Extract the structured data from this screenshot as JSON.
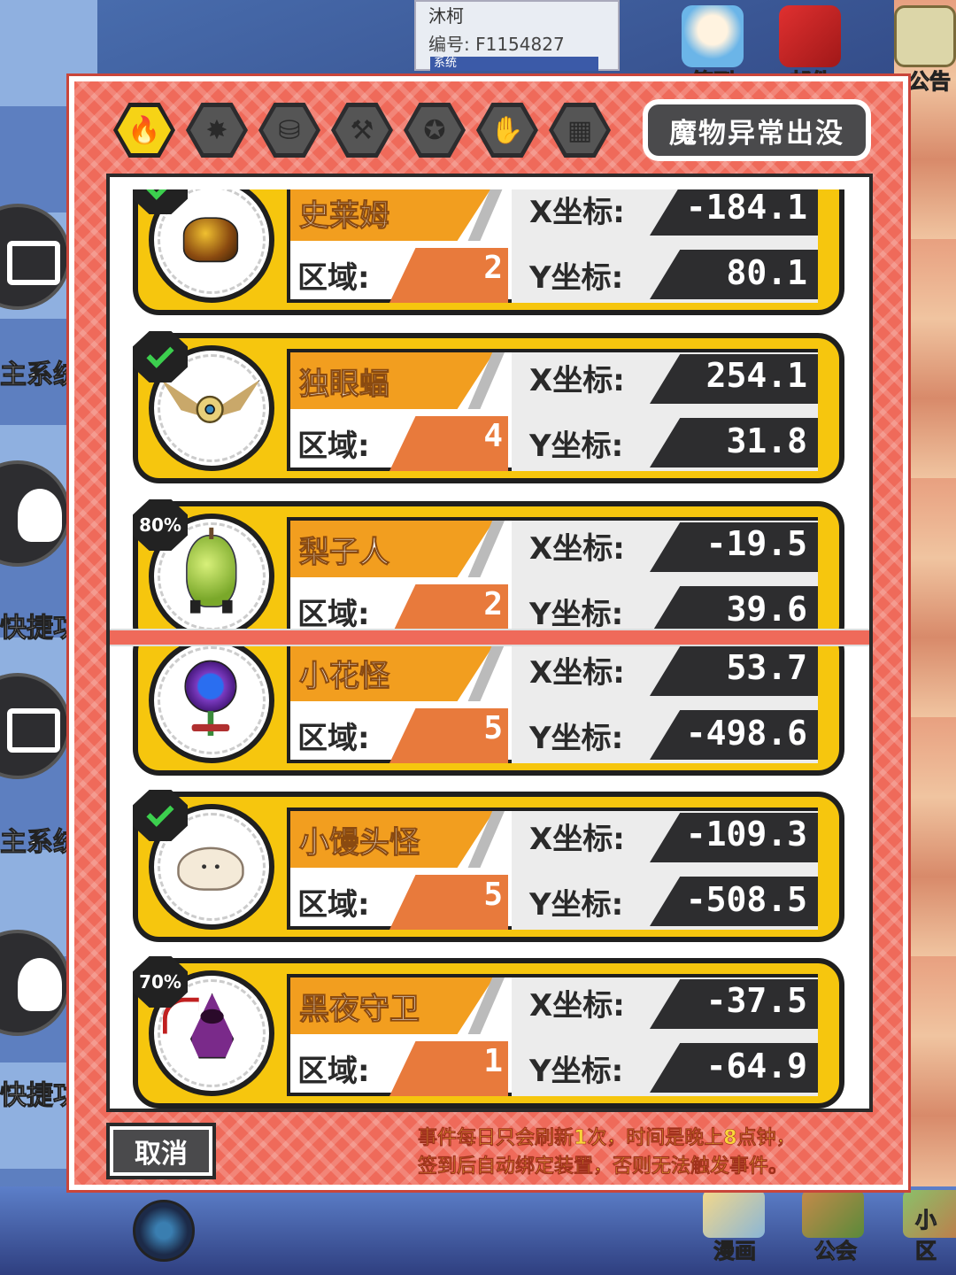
{
  "background": {
    "player_name": "沐柯",
    "player_id": "编号: F1154827",
    "system_label": "系统",
    "top_buttons": [
      {
        "label": "签到",
        "icon": "mascot-icon"
      },
      {
        "label": "邮件",
        "icon": "mail-icon"
      },
      {
        "label": "公告",
        "icon": "notice-board-icon"
      }
    ],
    "side_buttons": [
      {
        "label": "主系统",
        "icon": "window-icon"
      },
      {
        "label": "快捷功",
        "icon": "lightbulb-icon"
      }
    ],
    "bottom_buttons": [
      {
        "label": "漫画",
        "icon": "comic-icon"
      },
      {
        "label": "公会",
        "icon": "guild-icon"
      },
      {
        "label": "小区",
        "icon": "house-icon"
      }
    ]
  },
  "dialog": {
    "title": "魔物异常出没",
    "tabs": [
      {
        "icon": "flame-icon",
        "glyph": "🔥",
        "active": true
      },
      {
        "icon": "fire-burst-icon",
        "glyph": "✸",
        "active": false
      },
      {
        "icon": "coins-icon",
        "glyph": "⛁",
        "active": false
      },
      {
        "icon": "hammer-icon",
        "glyph": "⚒",
        "active": false
      },
      {
        "icon": "star-coin-icon",
        "glyph": "✪",
        "active": false
      },
      {
        "icon": "glove-icon",
        "glyph": "✋",
        "active": false
      },
      {
        "icon": "grid-icon",
        "glyph": "▦",
        "active": false
      }
    ],
    "labels": {
      "region": "区域:",
      "x": "X坐标:",
      "y": "Y坐标:"
    },
    "monsters_top": [
      {
        "name": "史莱姆",
        "region": "2",
        "x": "-184.1",
        "y": "80.1",
        "badge": "check",
        "icon": "slime-icon"
      },
      {
        "name": "独眼蝠",
        "region": "4",
        "x": "254.1",
        "y": "31.8",
        "badge": "check",
        "icon": "one-eyed-bat-icon"
      },
      {
        "name": "梨子人",
        "region": "2",
        "x": "-19.5",
        "y": "39.6",
        "badge": "80%",
        "icon": "pear-man-icon"
      }
    ],
    "monsters_bottom": [
      {
        "name": "小花怪",
        "region": "5",
        "x": "53.7",
        "y": "-498.6",
        "badge": "",
        "icon": "flower-monster-icon"
      },
      {
        "name": "小馒头怪",
        "region": "5",
        "x": "-109.3",
        "y": "-508.5",
        "badge": "check",
        "icon": "bun-monster-icon"
      },
      {
        "name": "黑夜守卫",
        "region": "1",
        "x": "-37.5",
        "y": "-64.9",
        "badge": "70%",
        "icon": "night-guard-icon"
      }
    ],
    "cancel_label": "取消",
    "notice_lines": [
      "事件每日只会刷新1次，时间是晚上8点钟，",
      "签到后自动绑定装置，否则无法触发事件。"
    ],
    "colors": {
      "frame": "#ef6a5a",
      "card": "#f6c60e",
      "name_band": "#f29e1f",
      "region_band": "#e87a3c",
      "value_bg": "#2d2d2f",
      "check": "#3ccf4e",
      "notice_text": "#f9d53a"
    }
  }
}
